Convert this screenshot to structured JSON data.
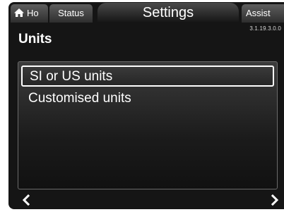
{
  "tabs": {
    "home_label": "Ho",
    "status_label": "Status",
    "settings_label": "Settings",
    "assist_label": "Assist"
  },
  "version": "3.1.19.3.0.0",
  "page": {
    "title": "Units"
  },
  "list": {
    "items": [
      {
        "label": "SI or US units",
        "selected": true
      },
      {
        "label": "Customised units",
        "selected": false
      }
    ]
  },
  "icons": {
    "home": "home-icon",
    "back": "chevron-left-icon",
    "forward": "chevron-right-icon"
  },
  "colors": {
    "background": "#151515",
    "text": "#ffffff",
    "selection_border": "#ffffff"
  }
}
